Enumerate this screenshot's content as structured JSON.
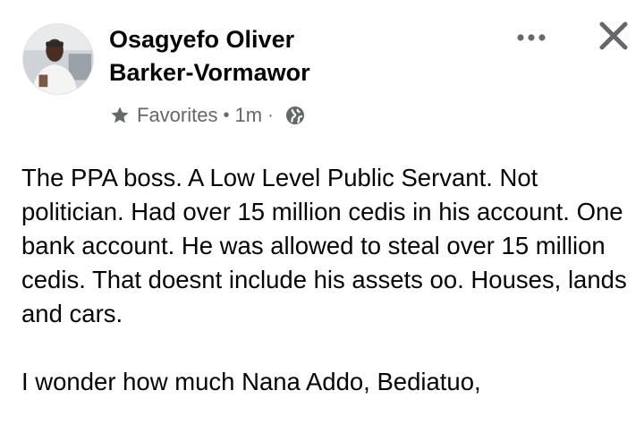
{
  "post": {
    "author": {
      "first_line": "Osagyefo Oliver",
      "second_line": "Barker-Vormawor"
    },
    "meta": {
      "audience_icon": "star-icon",
      "group": "Favorites",
      "separator": "•",
      "time": "1m",
      "dot": "·",
      "privacy_icon": "globe-icon"
    },
    "actions": {
      "more_icon": "more-horizontal-icon",
      "close_icon": "close-icon"
    },
    "paragraphs": [
      "The PPA boss. A Low Level Public Servant. Not politician. Had over 15 million cedis in his account. One bank account. He was allowed to steal over 15 million cedis. That doesnt include his assets oo. Houses, lands and cars.",
      "I wonder how much Nana Addo, Bediatuo,"
    ]
  },
  "colors": {
    "text_primary": "#050505",
    "text_secondary": "#65676b",
    "background": "#ffffff"
  }
}
